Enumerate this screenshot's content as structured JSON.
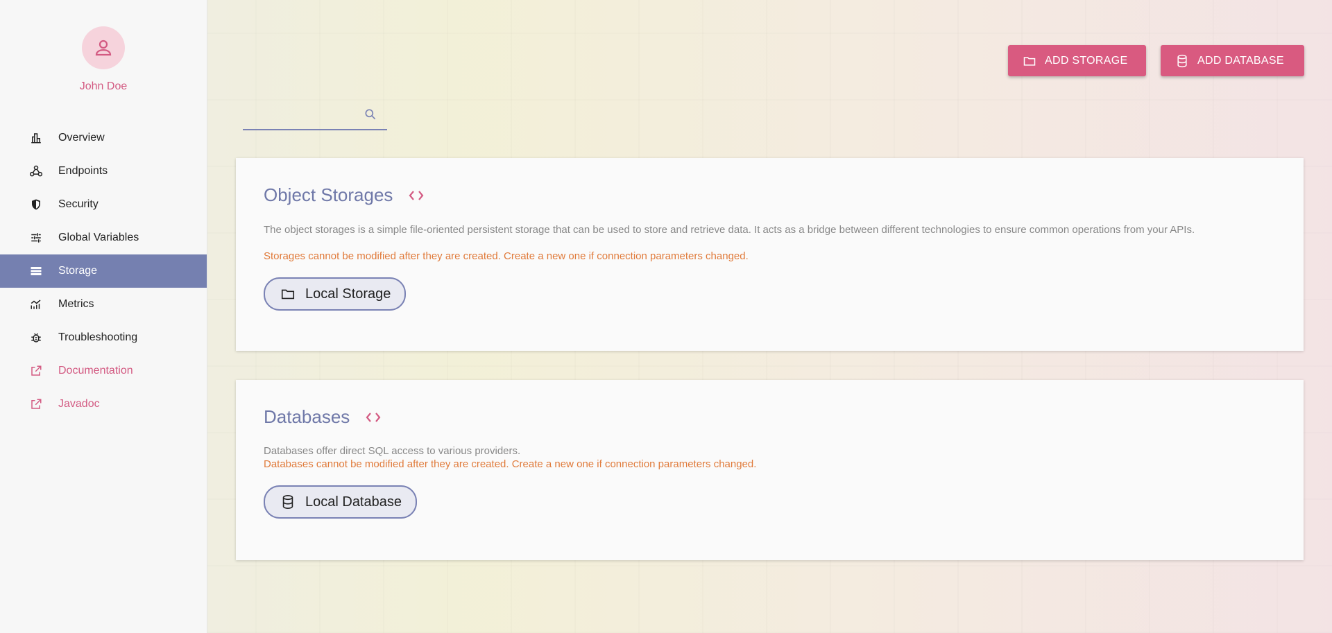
{
  "user": {
    "name": "John Doe",
    "avatar_icon": "person-icon"
  },
  "nav": [
    {
      "label": "Overview",
      "icon": "bar-chart-icon",
      "active": false,
      "link": false
    },
    {
      "label": "Endpoints",
      "icon": "webhook-icon",
      "active": false,
      "link": false
    },
    {
      "label": "Security",
      "icon": "shield-icon",
      "active": false,
      "link": false
    },
    {
      "label": "Global Variables",
      "icon": "sliders-icon",
      "active": false,
      "link": false
    },
    {
      "label": "Storage",
      "icon": "storage-icon",
      "active": true,
      "link": false
    },
    {
      "label": "Metrics",
      "icon": "metrics-icon",
      "active": false,
      "link": false
    },
    {
      "label": "Troubleshooting",
      "icon": "bug-icon",
      "active": false,
      "link": false
    },
    {
      "label": "Documentation",
      "icon": "external-link-icon",
      "active": false,
      "link": true
    },
    {
      "label": "Javadoc",
      "icon": "external-link-icon",
      "active": false,
      "link": true
    }
  ],
  "toolbar": {
    "add_storage_label": "ADD STORAGE",
    "add_database_label": "ADD DATABASE"
  },
  "search": {
    "placeholder": "",
    "value": ""
  },
  "storages": {
    "title": "Object Storages",
    "description": "The object storages is a simple file-oriented persistent storage that can be used to store and retrieve data. It acts as a bridge between different technologies to ensure common operations from your APIs.",
    "warning": "Storages cannot be modified after they are created. Create a new one if connection parameters changed.",
    "items": [
      {
        "label": "Local Storage",
        "icon": "folder-icon"
      }
    ]
  },
  "databases": {
    "title": "Databases",
    "description": "Databases offer direct SQL access to various providers.",
    "warning": "Databases cannot be modified after they are created. Create a new one if connection parameters changed.",
    "items": [
      {
        "label": "Local Database",
        "icon": "database-icon"
      }
    ]
  },
  "colors": {
    "accent": "#d95a80",
    "primary": "#7580b0",
    "warning": "#e07a3a",
    "sidebar_bg": "#f7f7f7"
  }
}
